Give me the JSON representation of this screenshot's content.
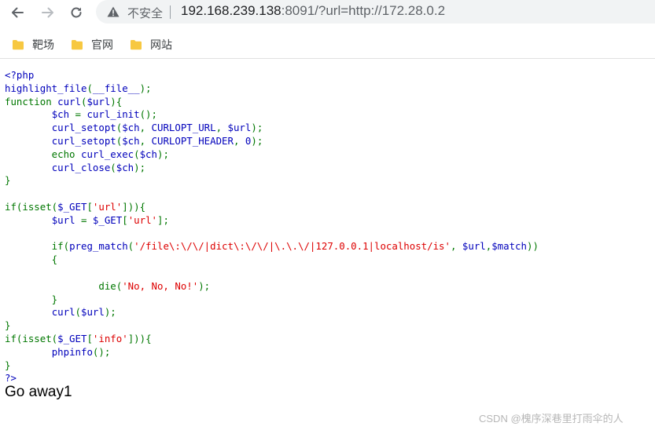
{
  "browser": {
    "security_label": "不安全",
    "url_host": "192.168.239.138",
    "url_rest": ":8091/?url=http://172.28.0.2",
    "bookmarks": [
      "靶场",
      "官网",
      "网站"
    ]
  },
  "icons": {
    "back": "arrow-left-icon",
    "forward": "arrow-right-icon",
    "reload": "reload-icon",
    "security": "warning-triangle-icon",
    "bookmark": "folder-icon"
  },
  "colors": {
    "php_default": "#007700",
    "php_variable": "#0000bb",
    "php_string": "#dd0000",
    "bookmark_folder": "#f7c841"
  },
  "code_lines": [
    [
      {
        "t": "<?php",
        "c": "df"
      }
    ],
    [
      {
        "t": "highlight_file",
        "c": "df"
      },
      {
        "t": "(",
        "c": "kw"
      },
      {
        "t": "__file__",
        "c": "df"
      },
      {
        "t": ");",
        "c": "kw"
      }
    ],
    [
      {
        "t": "function ",
        "c": "kw"
      },
      {
        "t": "curl",
        "c": "df"
      },
      {
        "t": "(",
        "c": "kw"
      },
      {
        "t": "$url",
        "c": "df"
      },
      {
        "t": "){",
        "c": "kw"
      }
    ],
    [
      {
        "t": "        ",
        "c": "kw"
      },
      {
        "t": "$ch ",
        "c": "df"
      },
      {
        "t": "= ",
        "c": "kw"
      },
      {
        "t": "curl_init",
        "c": "df"
      },
      {
        "t": "();",
        "c": "kw"
      }
    ],
    [
      {
        "t": "        ",
        "c": "kw"
      },
      {
        "t": "curl_setopt",
        "c": "df"
      },
      {
        "t": "(",
        "c": "kw"
      },
      {
        "t": "$ch",
        "c": "df"
      },
      {
        "t": ", ",
        "c": "kw"
      },
      {
        "t": "CURLOPT_URL",
        "c": "df"
      },
      {
        "t": ", ",
        "c": "kw"
      },
      {
        "t": "$url",
        "c": "df"
      },
      {
        "t": ");",
        "c": "kw"
      }
    ],
    [
      {
        "t": "        ",
        "c": "kw"
      },
      {
        "t": "curl_setopt",
        "c": "df"
      },
      {
        "t": "(",
        "c": "kw"
      },
      {
        "t": "$ch",
        "c": "df"
      },
      {
        "t": ", ",
        "c": "kw"
      },
      {
        "t": "CURLOPT_HEADER",
        "c": "df"
      },
      {
        "t": ", ",
        "c": "kw"
      },
      {
        "t": "0",
        "c": "df"
      },
      {
        "t": ");",
        "c": "kw"
      }
    ],
    [
      {
        "t": "        echo ",
        "c": "kw"
      },
      {
        "t": "curl_exec",
        "c": "df"
      },
      {
        "t": "(",
        "c": "kw"
      },
      {
        "t": "$ch",
        "c": "df"
      },
      {
        "t": ");",
        "c": "kw"
      }
    ],
    [
      {
        "t": "        ",
        "c": "kw"
      },
      {
        "t": "curl_close",
        "c": "df"
      },
      {
        "t": "(",
        "c": "kw"
      },
      {
        "t": "$ch",
        "c": "df"
      },
      {
        "t": ");",
        "c": "kw"
      }
    ],
    [
      {
        "t": "}",
        "c": "kw"
      }
    ],
    [],
    [
      {
        "t": "if(isset(",
        "c": "kw"
      },
      {
        "t": "$_GET",
        "c": "df"
      },
      {
        "t": "[",
        "c": "kw"
      },
      {
        "t": "'url'",
        "c": "st"
      },
      {
        "t": "])){",
        "c": "kw"
      }
    ],
    [
      {
        "t": "        ",
        "c": "kw"
      },
      {
        "t": "$url ",
        "c": "df"
      },
      {
        "t": "= ",
        "c": "kw"
      },
      {
        "t": "$_GET",
        "c": "df"
      },
      {
        "t": "[",
        "c": "kw"
      },
      {
        "t": "'url'",
        "c": "st"
      },
      {
        "t": "];",
        "c": "kw"
      }
    ],
    [],
    [
      {
        "t": "        if(",
        "c": "kw"
      },
      {
        "t": "preg_match",
        "c": "df"
      },
      {
        "t": "(",
        "c": "kw"
      },
      {
        "t": "'/file\\:\\/\\/|dict\\:\\/\\/|\\.\\.\\/|127.0.0.1|localhost/is'",
        "c": "st"
      },
      {
        "t": ", ",
        "c": "kw"
      },
      {
        "t": "$url",
        "c": "df"
      },
      {
        "t": ",",
        "c": "kw"
      },
      {
        "t": "$match",
        "c": "df"
      },
      {
        "t": "))",
        "c": "kw"
      }
    ],
    [
      {
        "t": "        {",
        "c": "kw"
      }
    ],
    [],
    [
      {
        "t": "                ",
        "c": "kw"
      },
      {
        "t": "die",
        "c": "kw"
      },
      {
        "t": "(",
        "c": "kw"
      },
      {
        "t": "'No, No, No!'",
        "c": "st"
      },
      {
        "t": ");",
        "c": "kw"
      }
    ],
    [
      {
        "t": "        }",
        "c": "kw"
      }
    ],
    [
      {
        "t": "        ",
        "c": "kw"
      },
      {
        "t": "curl",
        "c": "df"
      },
      {
        "t": "(",
        "c": "kw"
      },
      {
        "t": "$url",
        "c": "df"
      },
      {
        "t": ");",
        "c": "kw"
      }
    ],
    [
      {
        "t": "}",
        "c": "kw"
      }
    ],
    [
      {
        "t": "if(isset(",
        "c": "kw"
      },
      {
        "t": "$_GET",
        "c": "df"
      },
      {
        "t": "[",
        "c": "kw"
      },
      {
        "t": "'info'",
        "c": "st"
      },
      {
        "t": "])){",
        "c": "kw"
      }
    ],
    [
      {
        "t": "        ",
        "c": "kw"
      },
      {
        "t": "phpinfo",
        "c": "df"
      },
      {
        "t": "();",
        "c": "kw"
      }
    ],
    [
      {
        "t": "}",
        "c": "kw"
      }
    ],
    [
      {
        "t": "?>",
        "c": "df"
      }
    ]
  ],
  "output_text": "Go away1",
  "watermark": "CSDN @槐序深巷里打雨伞的人"
}
